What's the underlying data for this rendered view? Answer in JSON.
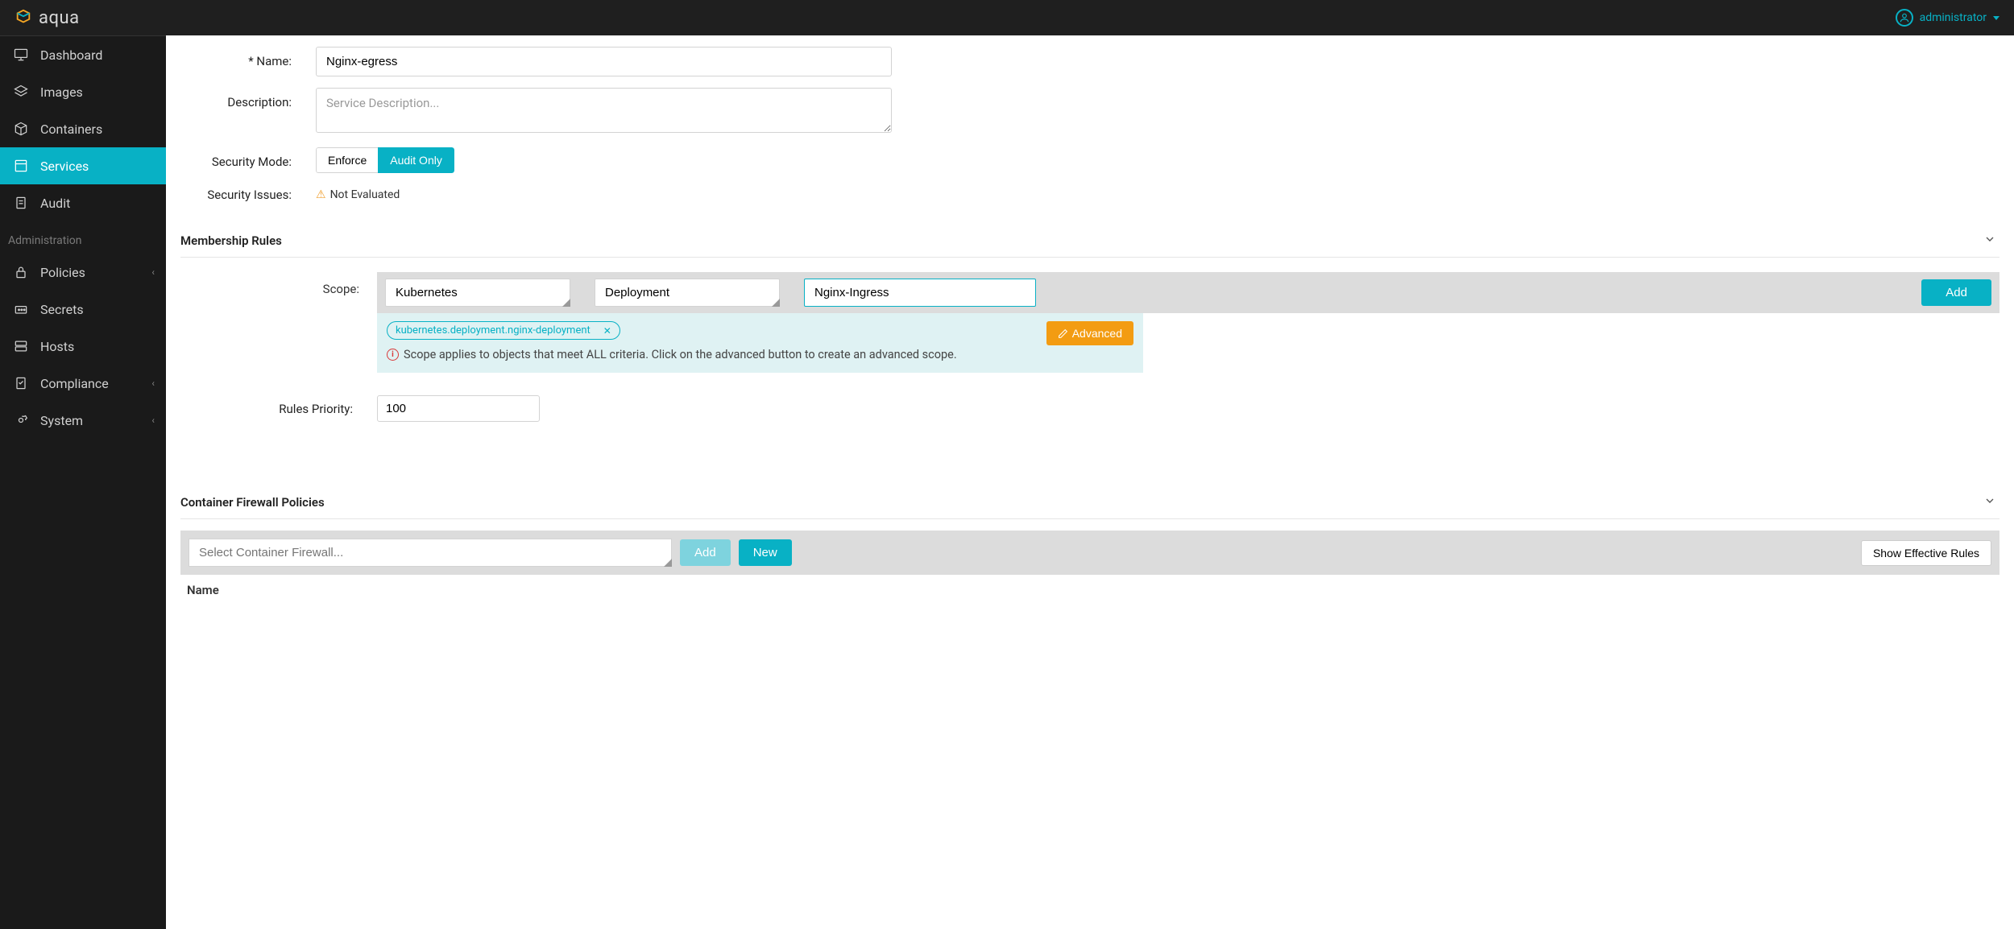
{
  "brand": "aqua",
  "header": {
    "user": "administrator"
  },
  "sidebar": {
    "items": [
      {
        "label": "Dashboard"
      },
      {
        "label": "Images"
      },
      {
        "label": "Containers"
      },
      {
        "label": "Services"
      },
      {
        "label": "Audit"
      }
    ],
    "admin_section": "Administration",
    "admin_items": [
      {
        "label": "Policies",
        "expandable": true
      },
      {
        "label": "Secrets"
      },
      {
        "label": "Hosts"
      },
      {
        "label": "Compliance",
        "expandable": true
      },
      {
        "label": "System",
        "expandable": true
      }
    ]
  },
  "form": {
    "name_label": "* Name:",
    "name_value": "Nginx-egress",
    "desc_label": "Description:",
    "desc_placeholder": "Service Description...",
    "mode_label": "Security Mode:",
    "mode_enforce": "Enforce",
    "mode_audit": "Audit Only",
    "issues_label": "Security Issues:",
    "issues_value": "Not Evaluated"
  },
  "membership": {
    "title": "Membership Rules",
    "scope_label": "Scope:",
    "scope_sel1": "Kubernetes",
    "scope_sel2": "Deployment",
    "scope_val": "Nginx-Ingress",
    "add_btn": "Add",
    "adv_btn": "Advanced",
    "tag": "kubernetes.deployment.nginx-deployment",
    "hint": "Scope applies to objects that meet ALL criteria. Click on the advanced button to create an advanced scope.",
    "priority_label": "Rules Priority:",
    "priority_value": "100"
  },
  "firewall": {
    "title": "Container Firewall Policies",
    "select_placeholder": "Select Container Firewall...",
    "add": "Add",
    "new": "New",
    "show": "Show Effective Rules",
    "col_name": "Name"
  }
}
